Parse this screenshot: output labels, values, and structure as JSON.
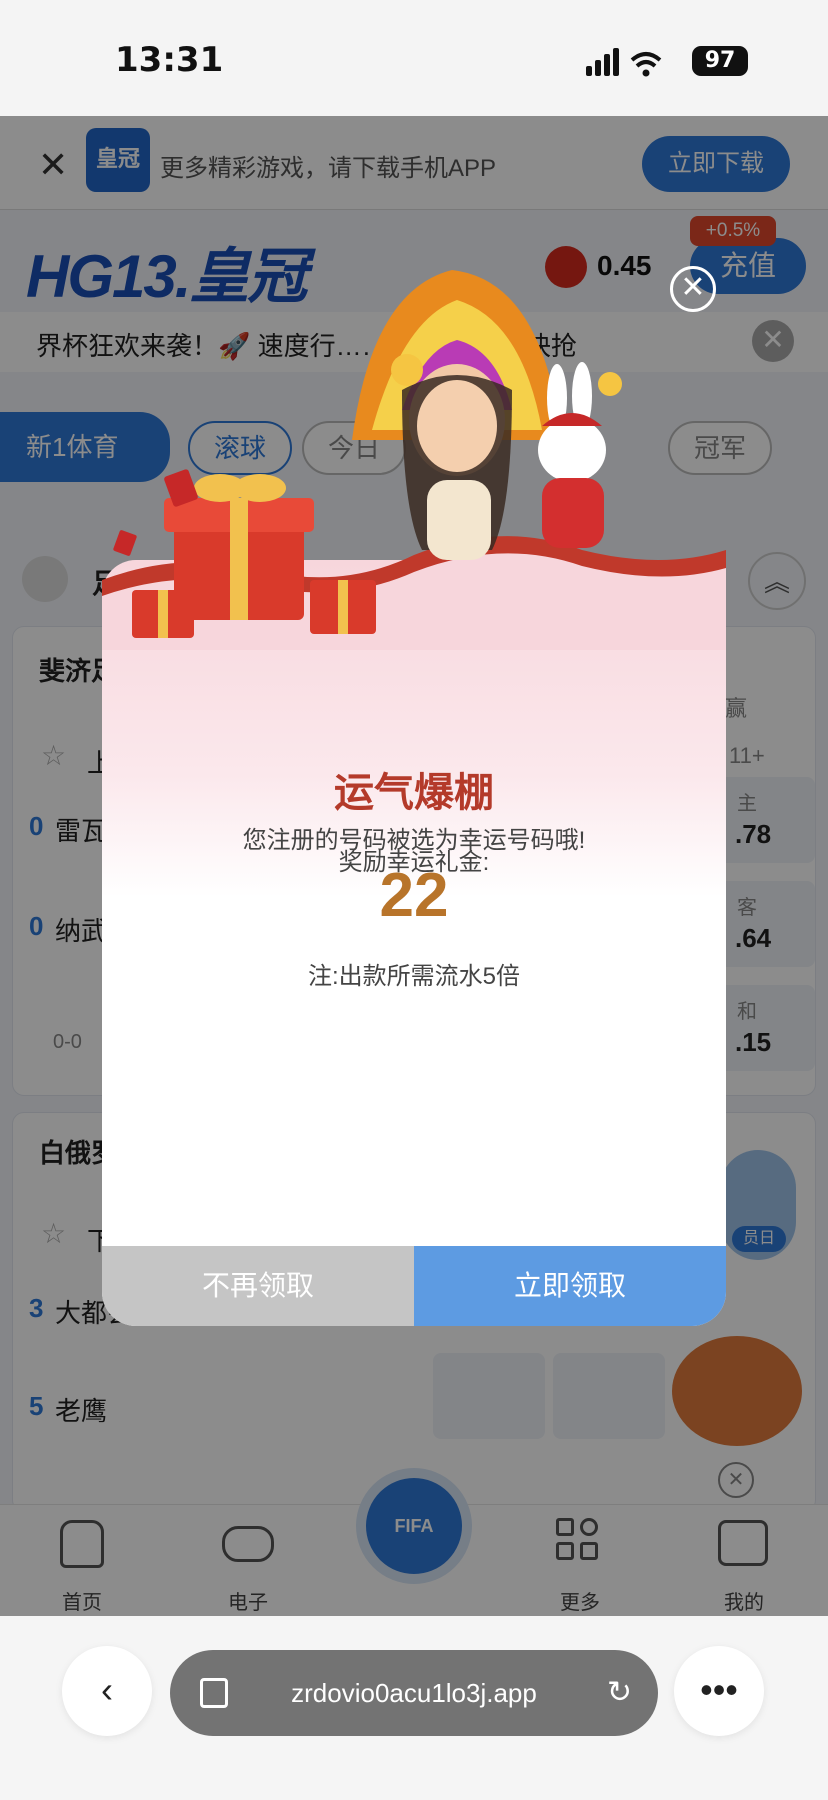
{
  "status": {
    "time": "13:31",
    "battery": "97"
  },
  "topbar": {
    "promo": "更多精彩游戏，请下载手机APP",
    "download_label": "立即下载",
    "logo_sm": "皇冠"
  },
  "header": {
    "brand": "HG13.皇冠",
    "balance": "0.45",
    "recharge_label": "充值",
    "bonus_tag": "+0.5%"
  },
  "marquee": {
    "text": "界杯狂欢来袭！🚀 速度行……奖金越高！ 快抢"
  },
  "sports": {
    "main_tab": "新1体育",
    "pills": [
      "滚球",
      "今日",
      "冠军"
    ]
  },
  "matches": {
    "section1": "斐济足",
    "section2": "白俄罗",
    "section1_header": "独赢",
    "more": "11+",
    "rows": [
      {
        "score": "0",
        "team": "雷瓦"
      },
      {
        "score": "0",
        "team": "纳武"
      },
      {
        "score": "3",
        "team": "大都会"
      },
      {
        "score": "5",
        "team": "老鹰"
      }
    ],
    "odds": [
      {
        "label": "主",
        "value": ".78"
      },
      {
        "label": "客",
        "value": ".64"
      },
      {
        "label": "和",
        "value": ".15"
      }
    ],
    "score_line": "0-0",
    "sport_label": "足球",
    "first_row": "上",
    "second_row": "下"
  },
  "nav": {
    "items": [
      "首页",
      "电子",
      "更多",
      "我的"
    ],
    "center": "FIFA"
  },
  "promo_widget": {
    "label": "员日"
  },
  "modal": {
    "title": "运气爆棚",
    "line1": "您注册的号码被选为幸运号码哦!",
    "line2": "奖励幸运礼金:",
    "amount": "22",
    "note": "注:出款所需流水5倍",
    "btn_decline": "不再领取",
    "btn_accept": "立即领取"
  },
  "browser": {
    "url": "zrdovio0acu1lo3j.app"
  },
  "colors": {
    "accent": "#2f78d8",
    "modal_title": "#b43a2a",
    "amount": "#b8742a",
    "accept": "#5d9be2",
    "decline": "#c5c5c5"
  }
}
